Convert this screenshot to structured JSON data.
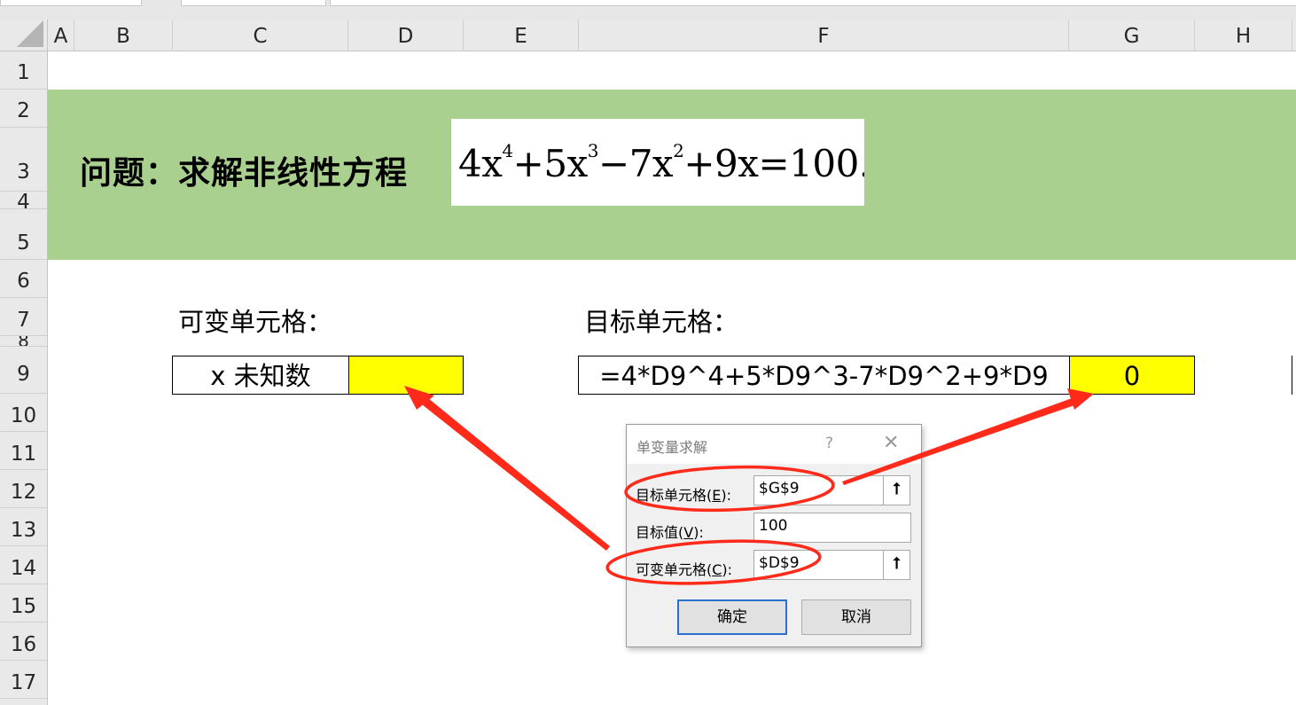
{
  "columns": [
    {
      "label": "A"
    },
    {
      "label": "B"
    },
    {
      "label": "C"
    },
    {
      "label": "D"
    },
    {
      "label": "E"
    },
    {
      "label": "F"
    },
    {
      "label": "G"
    },
    {
      "label": "H"
    }
  ],
  "rows": [
    "1",
    "2",
    "3",
    "4",
    "5",
    "6",
    "7",
    "8",
    "9",
    "10",
    "11",
    "12",
    "13",
    "14",
    "15",
    "16",
    "17"
  ],
  "banner": {
    "title": "问题：求解非线性方程",
    "equation": {
      "t1": "4x",
      "p1": "4",
      "t2": "+5x",
      "p2": "3",
      "t3": "−7x",
      "p3": "2",
      "t4": "+9x=100."
    },
    "color": "#a9d08e"
  },
  "variable_section": {
    "label": "可变单元格：",
    "cell_label": "x 未知数",
    "cell_value": ""
  },
  "target_section": {
    "label": "目标单元格：",
    "formula": "=4*D9^4+5*D9^3-7*D9^2+9*D9",
    "result": "0"
  },
  "dialog": {
    "title": "单变量求解",
    "help": "?",
    "close": "✕",
    "fields": {
      "target_cell": {
        "label_pre": "目标单元格(",
        "key": "E",
        "label_post": "):",
        "value": "$G$9"
      },
      "target_value": {
        "label_pre": "目标值(",
        "key": "V",
        "label_post": "):",
        "value": "100"
      },
      "changing_cell": {
        "label_pre": "可变单元格(",
        "key": "C",
        "label_post": "):",
        "value": "$D$9"
      }
    },
    "picker_glyph": "⭡",
    "ok": "确定",
    "cancel": "取消"
  },
  "colors": {
    "highlight": "#ffff00",
    "annotation": "#ff2a1a"
  }
}
